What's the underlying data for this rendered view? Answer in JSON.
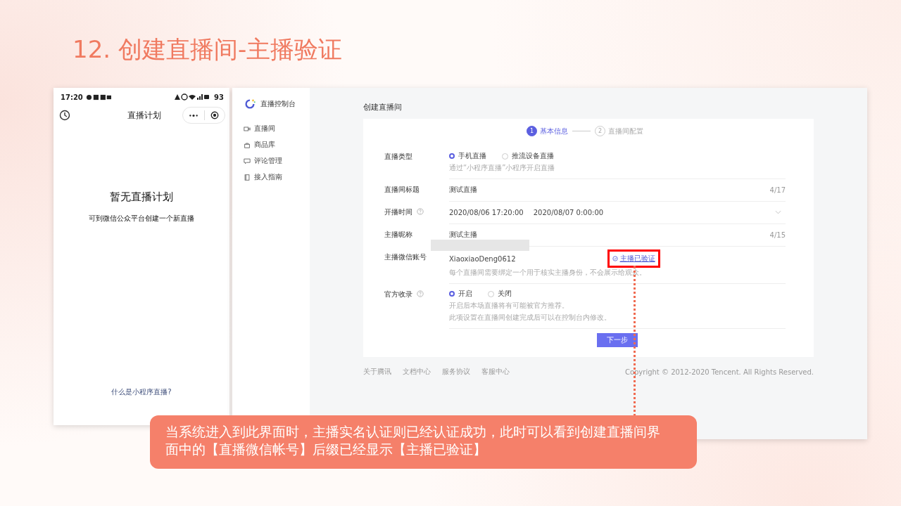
{
  "slide": {
    "title": "12. 创建直播间-主播验证"
  },
  "phone": {
    "time": "17:20",
    "battery": "93",
    "nav_title": "直播计划",
    "empty_title": "暂无直播计划",
    "empty_hint": "可到微信公众平台创建一个新直播",
    "help_link": "什么是小程序直播?"
  },
  "console": {
    "brand": "直播控制台",
    "nav_items": [
      {
        "kind": "video",
        "label": "直播间"
      },
      {
        "kind": "bag",
        "label": "商品库"
      },
      {
        "kind": "comment",
        "label": "评论管理"
      },
      {
        "kind": "book",
        "label": "接入指南"
      }
    ],
    "page_title": "创建直播间",
    "steps": [
      {
        "number": "1",
        "label": "基本信息",
        "selected": true
      },
      {
        "number": "2",
        "label": "直播间配置",
        "selected": false
      }
    ],
    "form": [
      {
        "kind": "radio",
        "label": "直播类型",
        "help": false,
        "options": [
          {
            "label": "手机直播",
            "selected": true
          },
          {
            "label": "推流设备直播",
            "selected": false
          }
        ],
        "hints": [
          "通过“小程序直播”小程序开启直播"
        ]
      },
      {
        "kind": "text",
        "label": "直播间标题",
        "help": false,
        "value": "测试直播",
        "counter": "4/17"
      },
      {
        "kind": "daterange",
        "label": "开播时间",
        "help": true,
        "start": "2020/08/06 17:20:00",
        "end": "2020/08/07 0:00:00"
      },
      {
        "kind": "text",
        "label": "主播昵称",
        "help": false,
        "value": "测试主播",
        "counter": "4/15"
      },
      {
        "kind": "account",
        "label": "主播微信账号",
        "help": false,
        "masked": true,
        "value": "XiaoxiaoDeng0612",
        "status": "主播已验证",
        "highlighted": true,
        "hints": [
          "每个直播间需要绑定一个用于核实主播身份，不会展示给观众。"
        ]
      },
      {
        "kind": "radio",
        "label": "官方收录",
        "help": true,
        "options": [
          {
            "label": "开启",
            "selected": true
          },
          {
            "label": "关闭",
            "selected": false
          }
        ],
        "hints": [
          "开启后本场直播将有可能被官方推荐。",
          "此项设置在直播间创建完成后可以在控制台内修改。"
        ]
      }
    ],
    "next_button": "下一步",
    "footer_links": [
      "关于腾讯",
      "文档中心",
      "服务协议",
      "客服中心"
    ],
    "copyright": "Copyright © 2012-2020 Tencent. All Rights Reserved."
  },
  "callout": {
    "text": "当系统进入到此界面时，主播实名认证则已经认证成功，此时可以看到创建直播间界面中的【直播微信帐号】后缀已经显示【主播已验证】"
  }
}
